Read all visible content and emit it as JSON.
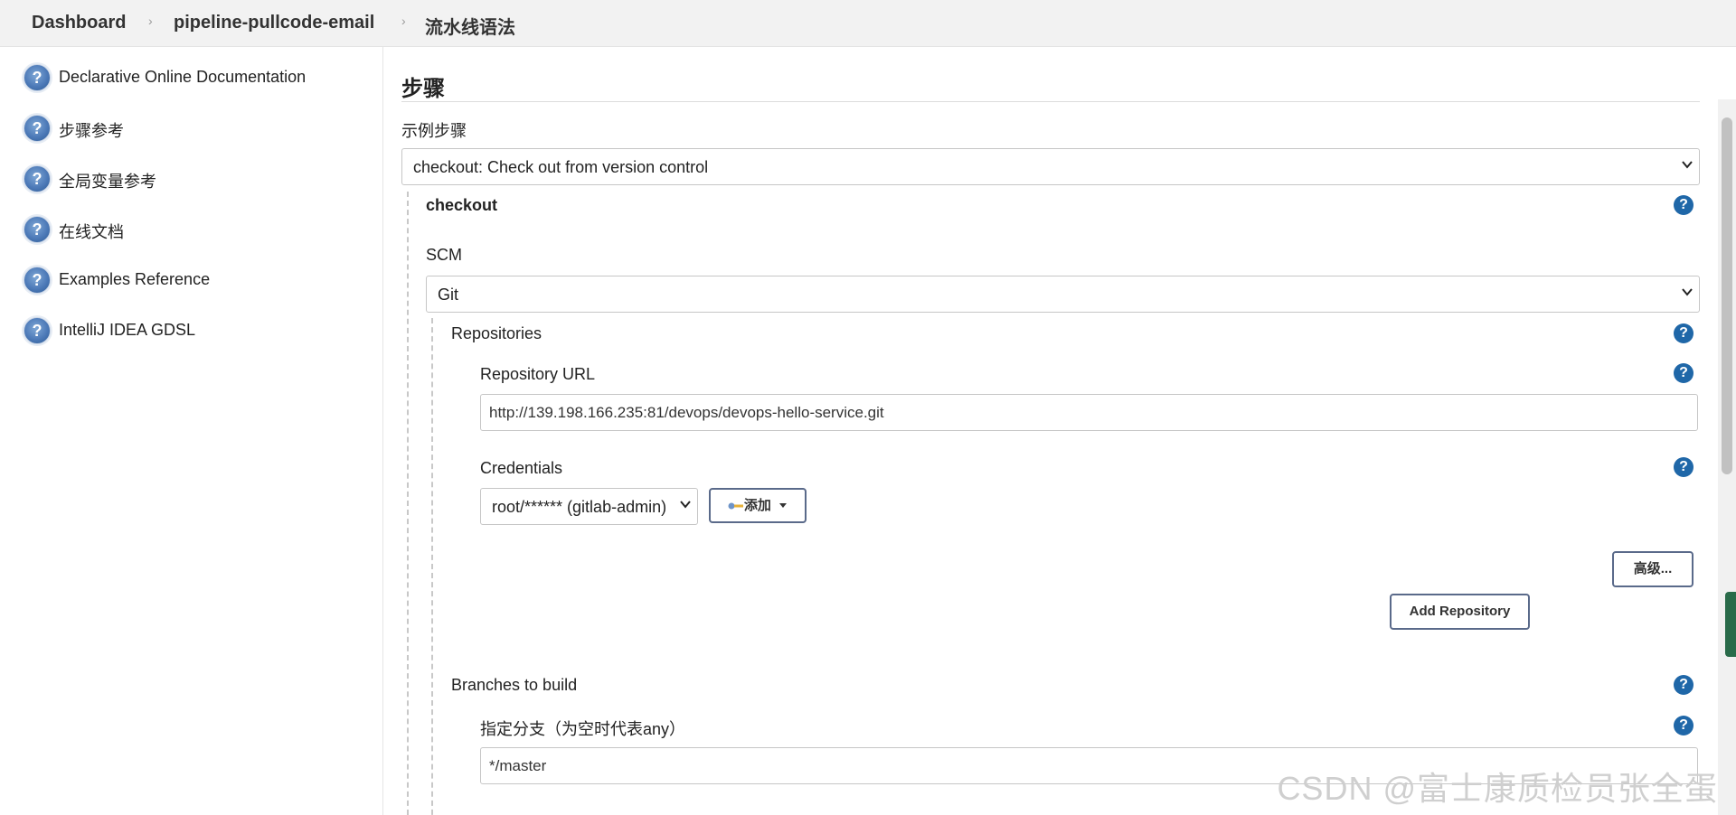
{
  "breadcrumb": {
    "items": [
      "Dashboard",
      "pipeline-pullcode-email",
      "流水线语法"
    ]
  },
  "sidebar": {
    "items": [
      {
        "label": "Declarative Online Documentation",
        "icon": "help-icon"
      },
      {
        "label": "步骤参考",
        "icon": "help-icon"
      },
      {
        "label": "全局变量参考",
        "icon": "help-icon"
      },
      {
        "label": "在线文档",
        "icon": "help-icon"
      },
      {
        "label": "Examples Reference",
        "icon": "help-icon"
      },
      {
        "label": "IntelliJ IDEA GDSL",
        "icon": "help-icon"
      }
    ]
  },
  "main": {
    "section_title": "步骤",
    "sample_step_label": "示例步骤",
    "sample_step_value": "checkout: Check out from version control",
    "checkout_title": "checkout",
    "scm_label": "SCM",
    "scm_value": "Git",
    "repositories_label": "Repositories",
    "repo_url_label": "Repository URL",
    "repo_url_value": "http://139.198.166.235:81/devops/devops-hello-service.git",
    "credentials_label": "Credentials",
    "credentials_value": "root/****** (gitlab-admin)",
    "add_button_label": "添加",
    "advanced_button_label": "高级...",
    "add_repository_label": "Add Repository",
    "branches_label": "Branches to build",
    "branch_specifier_label": "指定分支（为空时代表any）",
    "branch_specifier_value": "*/master",
    "help_glyph": "?"
  },
  "watermark": "CSDN @富士康质检员张全蛋",
  "colors": {
    "help_blue": "#1f67a8",
    "topbar_bg": "#f2f2f2",
    "button_border": "#5a6a8a"
  }
}
